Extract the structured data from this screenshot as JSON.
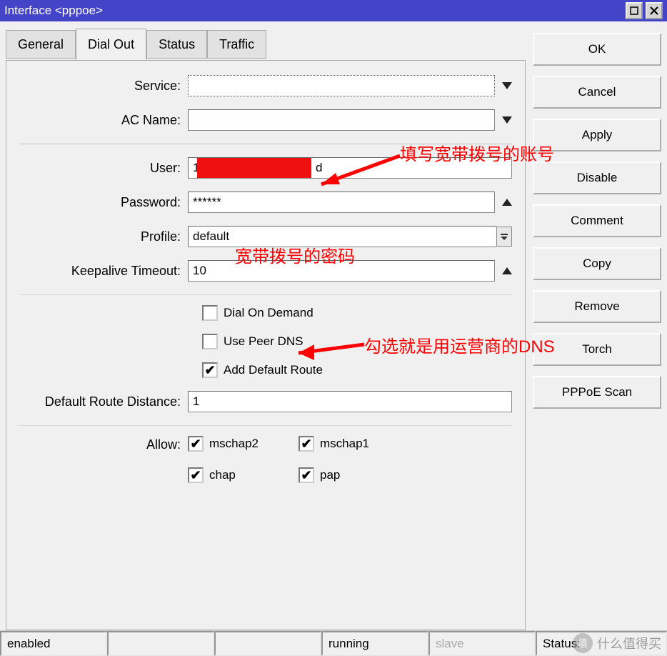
{
  "window": {
    "title": "Interface <pppoe>"
  },
  "tabs": {
    "general": "General",
    "dialout": "Dial Out",
    "status": "Status",
    "traffic": "Traffic"
  },
  "form": {
    "service_label": "Service:",
    "service_value": "",
    "acname_label": "AC Name:",
    "acname_value": "",
    "user_label": "User:",
    "user_prefix": "1",
    "user_suffix": "d",
    "password_label": "Password:",
    "password_value": "******",
    "profile_label": "Profile:",
    "profile_value": "default",
    "keepalive_label": "Keepalive Timeout:",
    "keepalive_value": "10",
    "dial_on_demand_label": "Dial On Demand",
    "dial_on_demand_checked": false,
    "use_peer_dns_label": "Use Peer DNS",
    "use_peer_dns_checked": false,
    "add_default_route_label": "Add Default Route",
    "add_default_route_checked": true,
    "default_route_distance_label": "Default Route Distance:",
    "default_route_distance_value": "1",
    "allow_label": "Allow:",
    "allow": {
      "mschap2_label": "mschap2",
      "mschap2_checked": true,
      "mschap1_label": "mschap1",
      "mschap1_checked": true,
      "chap_label": "chap",
      "chap_checked": true,
      "pap_label": "pap",
      "pap_checked": true
    }
  },
  "buttons": {
    "ok": "OK",
    "cancel": "Cancel",
    "apply": "Apply",
    "disable": "Disable",
    "comment": "Comment",
    "copy": "Copy",
    "remove": "Remove",
    "torch": "Torch",
    "pppoe_scan": "PPPoE Scan"
  },
  "status": {
    "enabled": "enabled",
    "running": "running",
    "slave": "slave",
    "status_prefix": "Status:"
  },
  "annotations": {
    "user_note": "填写宽带拨号的账号",
    "password_note": "宽带拨号的密码",
    "dns_note": "勾选就是用运营商的DNS"
  },
  "watermark": {
    "text": "什么值得买"
  }
}
